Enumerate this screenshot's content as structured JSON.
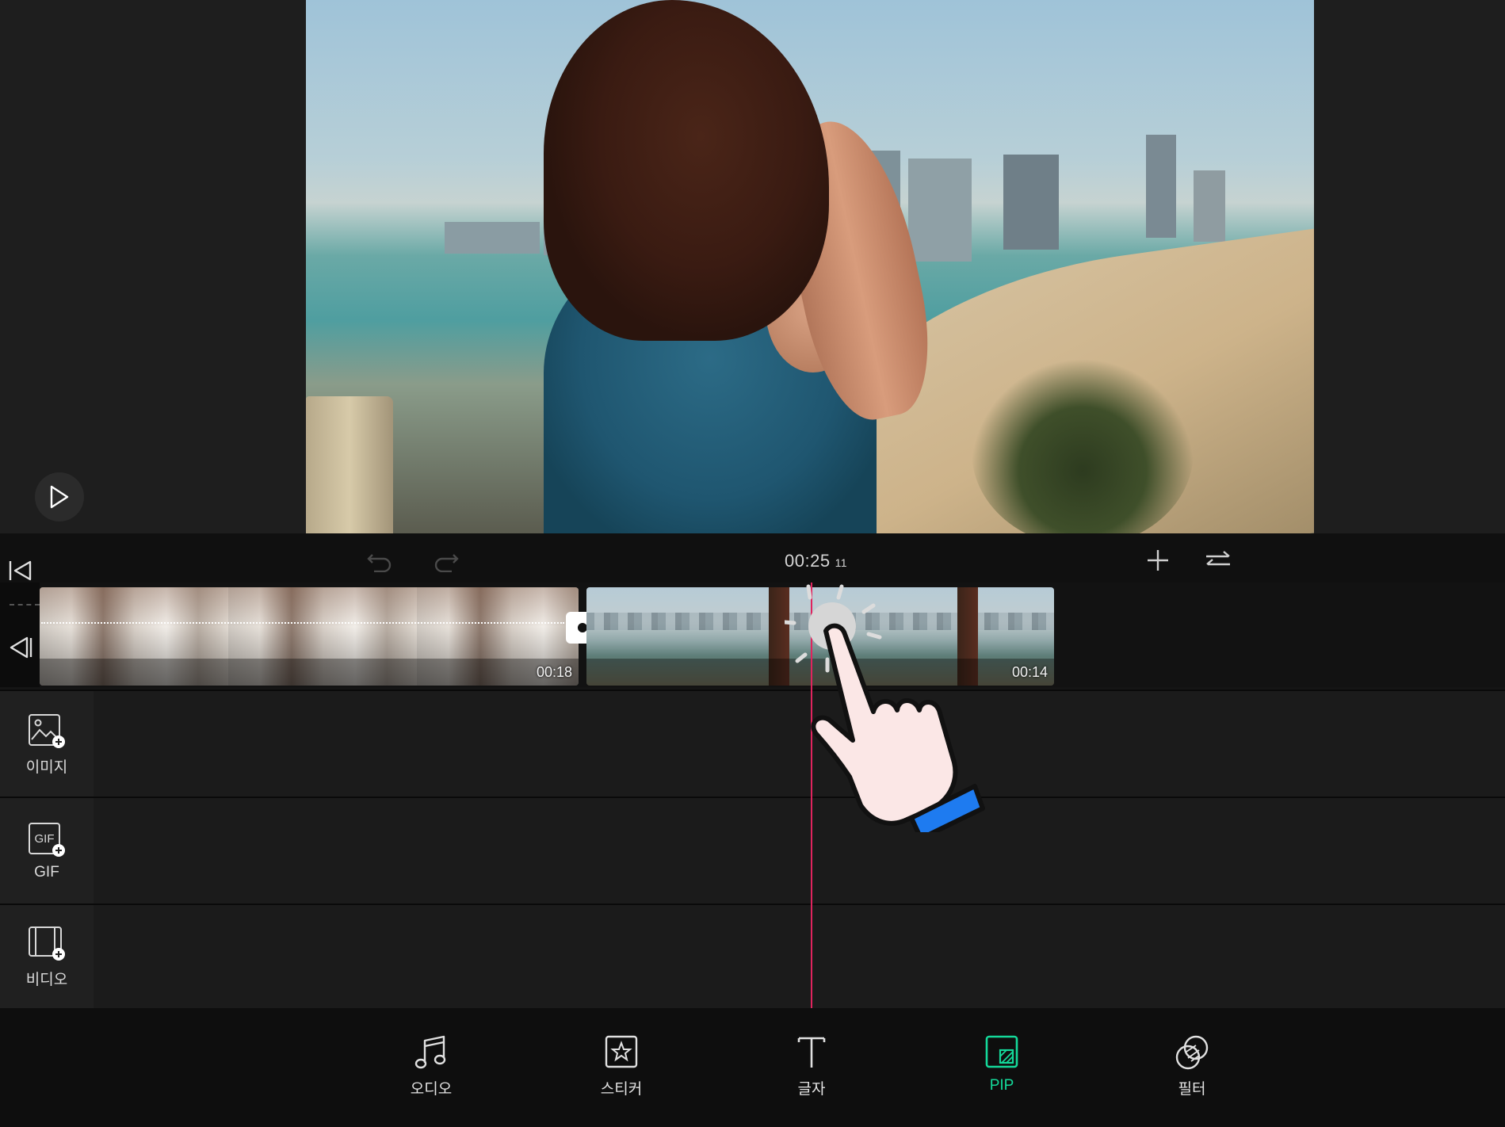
{
  "preview": {
    "play_icon": "play-icon"
  },
  "toolbar": {
    "time": "00:25",
    "frames": "11",
    "icons": [
      "jump-to-start-icon",
      "undo-icon",
      "redo-icon",
      "add-icon",
      "swap-icon"
    ]
  },
  "timeline": {
    "clips": [
      {
        "duration": "00:18"
      },
      {
        "duration": "00:14"
      }
    ],
    "tracks": [
      {
        "label": "이미지",
        "icon": "add-image-icon"
      },
      {
        "label": "GIF",
        "icon": "add-gif-icon"
      },
      {
        "label": "비디오",
        "icon": "add-video-icon"
      }
    ]
  },
  "menu": [
    {
      "label": "오디오",
      "icon": "music-note-icon"
    },
    {
      "label": "스티커",
      "icon": "sticker-icon"
    },
    {
      "label": "글자",
      "icon": "text-icon"
    },
    {
      "label": "PIP",
      "icon": "pip-icon",
      "active": true
    },
    {
      "label": "필터",
      "icon": "filter-icon"
    }
  ],
  "colors": {
    "accent": "#14d99a",
    "playhead": "#e0245e",
    "hand_cuff": "#1e7bf0"
  }
}
